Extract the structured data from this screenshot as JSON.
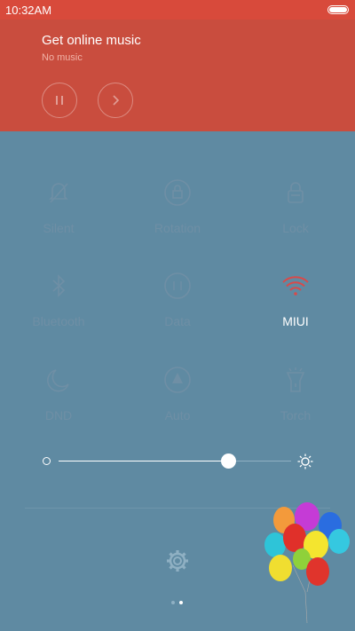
{
  "status_bar": {
    "time": "10:32AM"
  },
  "music": {
    "title": "Get online music",
    "subtitle": "No music"
  },
  "toggles": [
    {
      "label": "Silent",
      "icon": "silent-icon",
      "active": false
    },
    {
      "label": "Rotation",
      "icon": "rotation-lock-icon",
      "active": false
    },
    {
      "label": "Lock",
      "icon": "lock-icon",
      "active": false
    },
    {
      "label": "Bluetooth",
      "icon": "bluetooth-icon",
      "active": false
    },
    {
      "label": "Data",
      "icon": "data-icon",
      "active": false
    },
    {
      "label": "MIUI",
      "icon": "wifi-icon",
      "active": true
    },
    {
      "label": "DND",
      "icon": "moon-icon",
      "active": false
    },
    {
      "label": "Auto",
      "icon": "auto-brightness-icon",
      "active": false
    },
    {
      "label": "Torch",
      "icon": "torch-icon",
      "active": false
    }
  ],
  "brightness": {
    "level": 0.73
  },
  "colors": {
    "status_bar": "#d84a3b",
    "music_panel": "#c94d3e",
    "background": "#5f8aa2",
    "inactive": "#6f8fa5",
    "active_wifi": "#d84a4a"
  }
}
